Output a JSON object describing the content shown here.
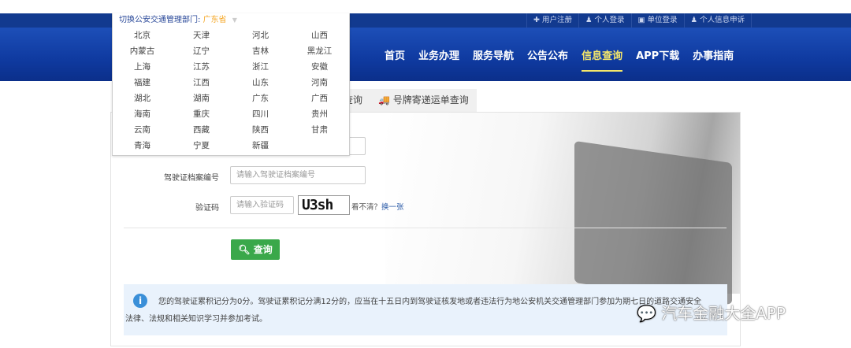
{
  "header": {
    "top_links": [
      "✚ 用户注册",
      "♟ 个人登录",
      "▣ 单位登录",
      "♟ 个人信息申诉"
    ],
    "nav": [
      {
        "label": "首页"
      },
      {
        "label": "业务办理"
      },
      {
        "label": "服务导航"
      },
      {
        "label": "公告公布"
      },
      {
        "label": "信息查询",
        "active": true
      },
      {
        "label": "APP下载"
      },
      {
        "label": "办事指南"
      }
    ]
  },
  "dept_switch": {
    "label": "切换公安交通管理部门:",
    "current": "广东省",
    "provinces": [
      "北京",
      "天津",
      "河北",
      "山西",
      "内蒙古",
      "辽宁",
      "吉林",
      "黑龙江",
      "上海",
      "江苏",
      "浙江",
      "安徽",
      "福建",
      "江西",
      "山东",
      "河南",
      "湖北",
      "湖南",
      "广东",
      "广西",
      "海南",
      "重庆",
      "四川",
      "贵州",
      "云南",
      "西藏",
      "陕西",
      "甘肃",
      "青海",
      "宁夏",
      "新疆"
    ]
  },
  "tabs": [
    "查询",
    "号牌寄递运单查询"
  ],
  "form": {
    "file_label": "驾驶证档案编号",
    "file_placeholder": "请输入驾驶证档案编号",
    "captcha_label": "验证码",
    "captcha_placeholder": "请输入验证码",
    "captcha_text": "U3sh",
    "unclear": "看不清？",
    "refresh": "换一张",
    "submit": "查询"
  },
  "info": {
    "line1": "您的驾驶证累积记分为0分。驾驶证累积记分满12分的，应当在十五日内到驾驶证核发地或者违法行为地公安机关交通管理部门参加为期七日的道路交通安全",
    "line2": "法律、法规和相关知识学习并参加考试。"
  },
  "watermark": "汽车金融大全APP"
}
